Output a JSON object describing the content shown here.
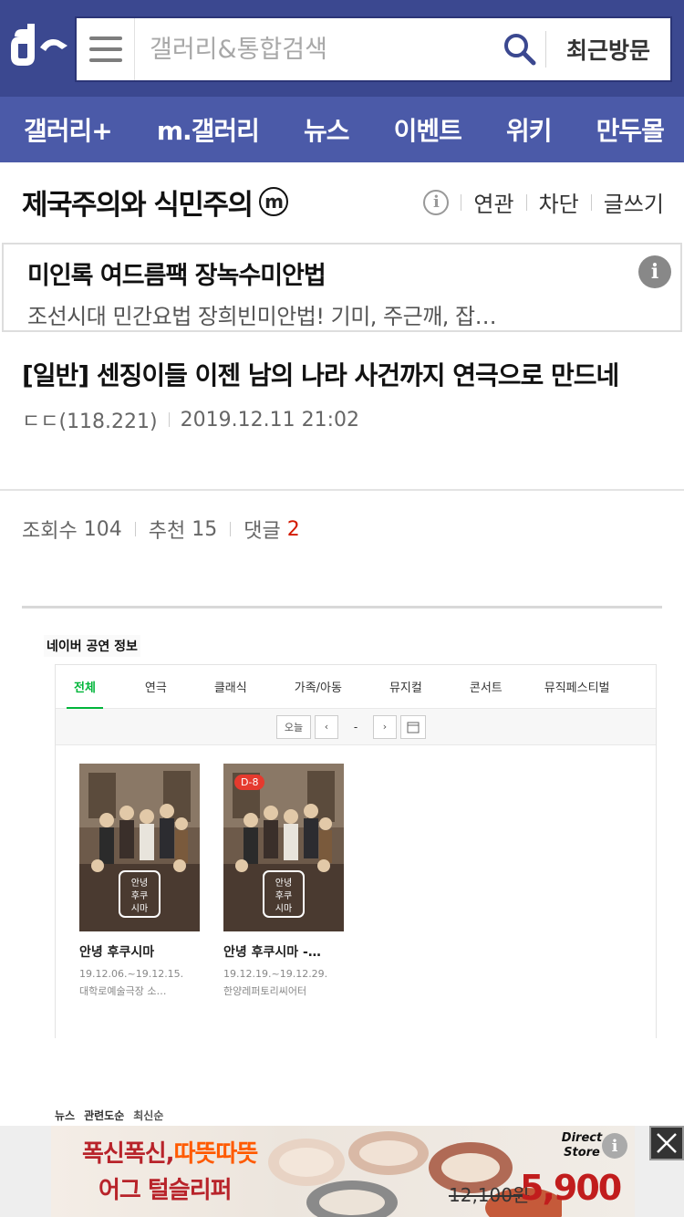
{
  "header": {
    "search_placeholder": "갤러리&통합검색",
    "recent_label": "최근방문"
  },
  "nav": {
    "items": [
      "갤러리+",
      "m.갤러리",
      "뉴스",
      "이벤트",
      "위키",
      "만두몰"
    ]
  },
  "gallery": {
    "title": "제국주의와 식민주의",
    "badge": "m",
    "info_icon": "i",
    "actions": [
      "연관",
      "차단",
      "글쓰기"
    ]
  },
  "ad": {
    "title": "미인록 여드름팩 장녹수미안법",
    "desc": "조선시대 민간요법 장희빈미안법! 기미, 주근깨, 잡…",
    "info_icon": "i"
  },
  "post": {
    "title": "[일반] 센징이들 이젠 남의 나라 사건까지 연극으로 만드네",
    "author": "ㄷㄷ(118.221)",
    "datetime": "2019.12.11 21:02",
    "views_label": "조회수",
    "views": "104",
    "recommend_label": "추천",
    "recommend": "15",
    "reply_label": "댓글",
    "replies": "2"
  },
  "embed": {
    "title": "네이버 공연 정보",
    "tabs": [
      "전체",
      "연극",
      "클래식",
      "가족/아동",
      "뮤지컬",
      "콘서트",
      "뮤직페스티벌"
    ],
    "today_label": "오늘",
    "date_sep": "-",
    "prev_glyph": "‹",
    "next_glyph": "›",
    "posters": [
      {
        "name": "안녕 후쿠시마",
        "date": "19.12.06.~19.12.15.",
        "venue": "대학로예술극장 소…",
        "dday": ""
      },
      {
        "name": "안녕 후쿠시마 -…",
        "date": "19.12.19.~19.12.29.",
        "venue": "한양레퍼토리씨어터",
        "dday": "D-8"
      }
    ],
    "poster_logo_text": "안녕\n후쿠\n시마"
  },
  "related": {
    "items": [
      "뉴스",
      "관련도순",
      "최신순"
    ]
  },
  "banner": {
    "line1_a": "폭신폭신,",
    "line1_b": "따뜻따뜻",
    "line2": "어그 털슬리퍼",
    "store": "Direct Store",
    "old_price": "12,100원",
    "price": "5,900원",
    "info_icon": "i"
  },
  "colors": {
    "header_bg": "#3b4890",
    "nav_bg": "#4b5aa8",
    "reply_count": "#d31900",
    "tab_active": "#00b53a"
  }
}
